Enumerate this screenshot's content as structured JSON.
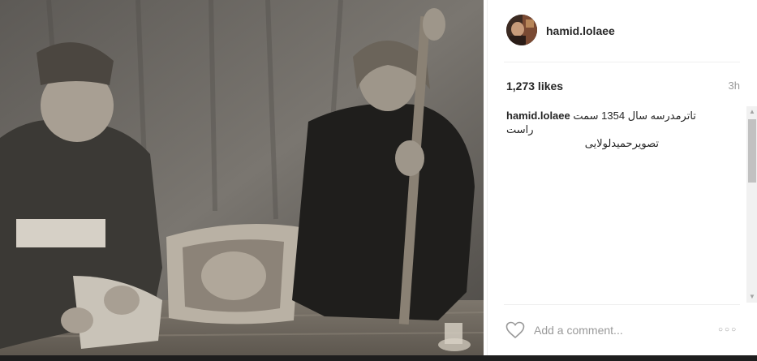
{
  "post": {
    "author": {
      "username": "hamid.lolaee",
      "avatar_icon": "avatar-photo"
    },
    "likes": "1,273 likes",
    "timestamp": "3h",
    "caption": {
      "username": "hamid.lolaee",
      "line1": "تاترمدرسه سال 1354 سمت راست",
      "line2": "تصویرحمیدلولایی"
    },
    "photo": {
      "description_icon": "black-and-white-photo"
    }
  },
  "comment": {
    "placeholder": "Add a comment...",
    "like_icon": "heart-outline-icon",
    "more_icon": "more-options-icon"
  },
  "colors": {
    "text": "#262626",
    "muted": "#999999",
    "divider": "#efefef"
  }
}
